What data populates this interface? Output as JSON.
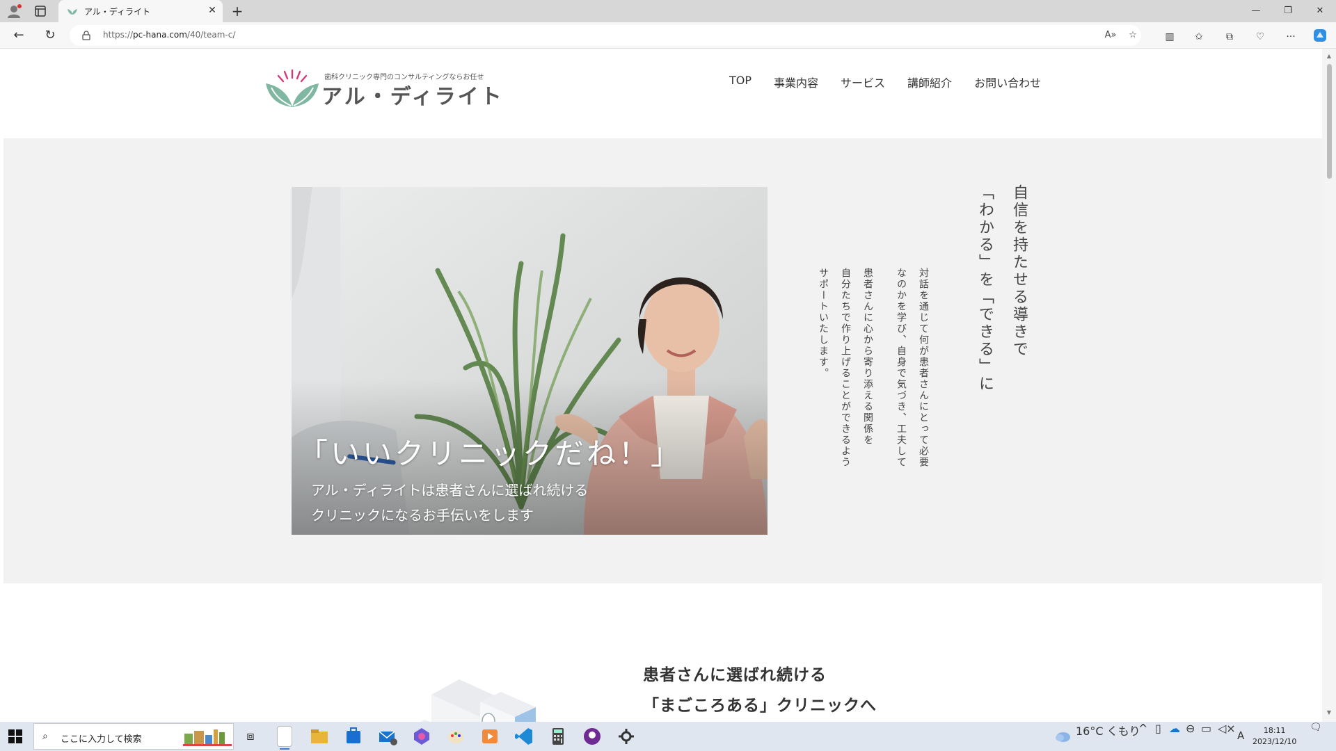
{
  "browser": {
    "tab_title": "アル・ディライト",
    "url_prefix": "https://",
    "url_host": "pc-hana.com",
    "url_path": "/40/team-c/"
  },
  "site": {
    "logo_tagline": "歯科クリニック専門のコンサルティングならお任せ",
    "logo_name": "アル・ディライト",
    "nav": [
      "TOP",
      "事業内容",
      "サービス",
      "講師紹介",
      "お問い合わせ"
    ]
  },
  "hero": {
    "caption_main": "「いいクリニックだね！」",
    "caption_sub_1": "アル・ディライトは患者さんに選ばれ続ける",
    "caption_sub_2": "クリニックになるお手伝いをします",
    "heading_line_1": "自信を持たせる導きで",
    "heading_line_2": "「わかる」を「できる」に",
    "body_lines": [
      "対話を通じて何が患者さんにとって必要",
      "なのかを学び、自身で気づき、工夫して",
      "患者さんに心から寄り添える関係を",
      "自分たちで作り上げることができるよう",
      "サポートいたします。"
    ]
  },
  "section2": {
    "title_line_1": "患者さんに選ばれ続ける",
    "title_line_2": "「まごころある」クリニックへ"
  },
  "taskbar": {
    "search_placeholder": "ここに入力して検索",
    "weather": "16°C くもり",
    "time": "18:11",
    "date": "2023/12/10",
    "ime": "A"
  },
  "colors": {
    "accent_green": "#7fb7a2",
    "logo_pink": "#d2397a",
    "hero_bg": "#f2f2f2"
  }
}
